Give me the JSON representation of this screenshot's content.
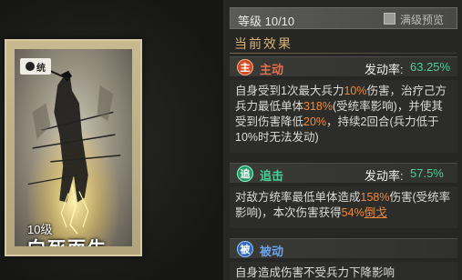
{
  "card": {
    "badge": "统",
    "level": "10级",
    "name": "向死而生"
  },
  "header": {
    "level_label": "等级 10/10",
    "preview_label": "满级预览",
    "section_title": "当前效果"
  },
  "skills": [
    {
      "icon_char": "主",
      "icon_name": "active-skill-icon",
      "type": "主动",
      "rate_label": "发动率:",
      "rate_value": "63.25%",
      "desc": [
        {
          "t": "自身受到1次最大兵力",
          "h": false
        },
        {
          "t": "10%",
          "h": true
        },
        {
          "t": "伤害，治疗己方兵力最低单体",
          "h": false
        },
        {
          "t": "318%",
          "h": true
        },
        {
          "t": "(受统率影响)，并使其受到伤害降低",
          "h": false
        },
        {
          "t": "20%",
          "h": true
        },
        {
          "t": "，持续2回合(兵力低于10%时无法发动)",
          "h": false
        }
      ]
    },
    {
      "icon_char": "追",
      "icon_name": "chase-skill-icon",
      "type": "追击",
      "rate_label": "发动率:",
      "rate_value": "57.5%",
      "desc": [
        {
          "t": "对敌方统率最低单体造成",
          "h": false
        },
        {
          "t": "158%",
          "h": true
        },
        {
          "t": "伤害(受统率影响)，本次伤害获得",
          "h": false
        },
        {
          "t": "54%",
          "h": true
        },
        {
          "t": "倒戈",
          "h": "ul"
        }
      ]
    },
    {
      "icon_char": "被",
      "icon_name": "passive-skill-icon",
      "type": "被动",
      "desc_partial": "自身造成伤害不受兵力下降影响"
    }
  ],
  "colors": {
    "active": "#e9704a",
    "chase": "#4ccf94",
    "passive": "#6aa4ee",
    "highlight": "#f08a3a",
    "section_title": "#d9b373"
  }
}
